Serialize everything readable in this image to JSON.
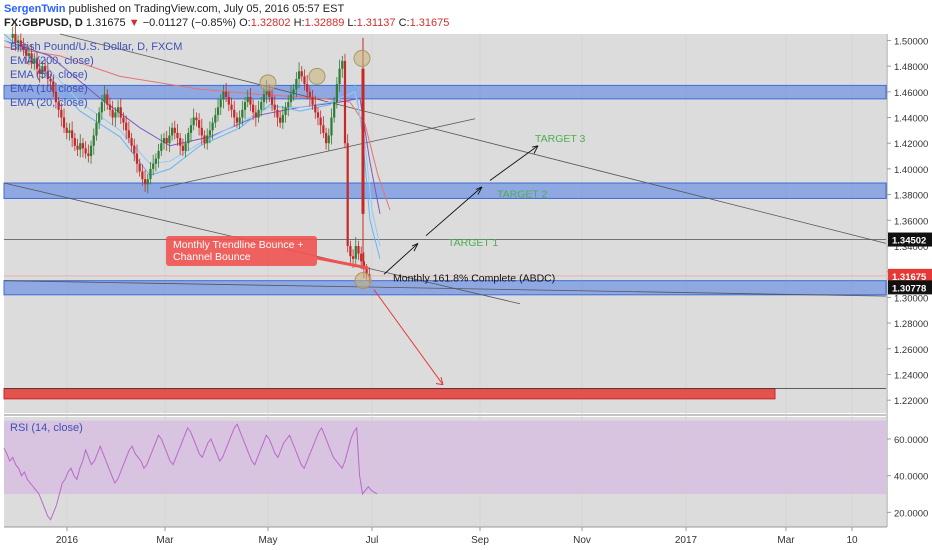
{
  "header": {
    "author": "SergenTwin",
    "published": "published on TradingView.com, July 05, 2016 05:57 EST",
    "symbol": "FX:GBPUSD, D",
    "last": "1.31675",
    "change_arrow": "▼",
    "change": "−0.01127 (−0.85%)",
    "o_label": "O:",
    "o": "1.32802",
    "h_label": "H:",
    "h": "1.32889",
    "l_label": "L:",
    "l": "1.31137",
    "c_label": "C:",
    "c": "1.31675"
  },
  "legend": {
    "title": "British Pound/U.S. Dollar, D, FXCM",
    "items": [
      "EMA (200, close)",
      "EMA (50, close)",
      "EMA (10, close)",
      "EMA (20, close)"
    ],
    "rsi": "RSI (14, close)"
  },
  "annotations": {
    "callout_line1": "Monthly Trendline Bounce +",
    "callout_line2": "Channel Bounce",
    "target1": "TARGET 1",
    "target2": "TARGET 2",
    "target3": "TARGET 3",
    "fib": "Monthly 161.8% Complete (ABDC)"
  },
  "colors": {
    "background": "#dcdcdc",
    "zone_blue": "#5b86e5",
    "zone_red": "#e53935",
    "up_candle": "#2e7d32",
    "down_candle": "#c62828",
    "ema200": "#e57373",
    "ema50": "#7e57c2",
    "ema10": "#64b5f6",
    "ema20": "#90caf9",
    "rsi_line": "#ba68c8",
    "rsi_band": "#d8c3e0",
    "target_text": "#4caf50",
    "callout": "#ef5350"
  },
  "chart_data": {
    "type": "candlestick",
    "price_axis": {
      "ticks": [
        "1.50000",
        "1.48000",
        "1.46000",
        "1.44000",
        "1.42000",
        "1.40000",
        "1.38000",
        "1.36000",
        "1.34000",
        "1.32000",
        "1.30000",
        "1.28000",
        "1.26000",
        "1.24000",
        "1.22000"
      ],
      "ylim": [
        1.21,
        1.505
      ],
      "markers": [
        {
          "label": "1.34502",
          "value": 1.34502,
          "style": "dark"
        },
        {
          "label": "1.31675",
          "value": 1.31675,
          "style": "red"
        },
        {
          "label": "1.30778",
          "value": 1.30778,
          "style": "dark"
        }
      ]
    },
    "rsi_axis": {
      "ticks": [
        "60.0000",
        "40.0000",
        "20.0000"
      ],
      "ylim": [
        12,
        72
      ],
      "band": [
        30,
        70
      ]
    },
    "x_axis": {
      "labels": [
        "2016",
        "Mar",
        "May",
        "Jul",
        "Sep",
        "Nov",
        "2017",
        "Mar",
        "10"
      ]
    },
    "zones": [
      {
        "color": "blue",
        "from": 1.4545,
        "to": 1.465
      },
      {
        "color": "blue",
        "from": 1.377,
        "to": 1.389
      },
      {
        "color": "blue",
        "from": 1.302,
        "to": 1.313
      },
      {
        "color": "red",
        "from": 1.221,
        "to": 1.229
      }
    ],
    "horizontal_lines": [
      1.345,
      1.229
    ],
    "ema_levels": [
      1.345
    ],
    "candles_summary": {
      "start": "2015-12",
      "end": "2016-07-05",
      "brexit_low": 1.31137,
      "pre_vote_high": 1.5
    },
    "series": [
      {
        "name": "EMA (200, close)"
      },
      {
        "name": "EMA (50, close)"
      },
      {
        "name": "EMA (10, close)"
      },
      {
        "name": "EMA (20, close)"
      },
      {
        "name": "RSI (14, close)"
      }
    ]
  }
}
